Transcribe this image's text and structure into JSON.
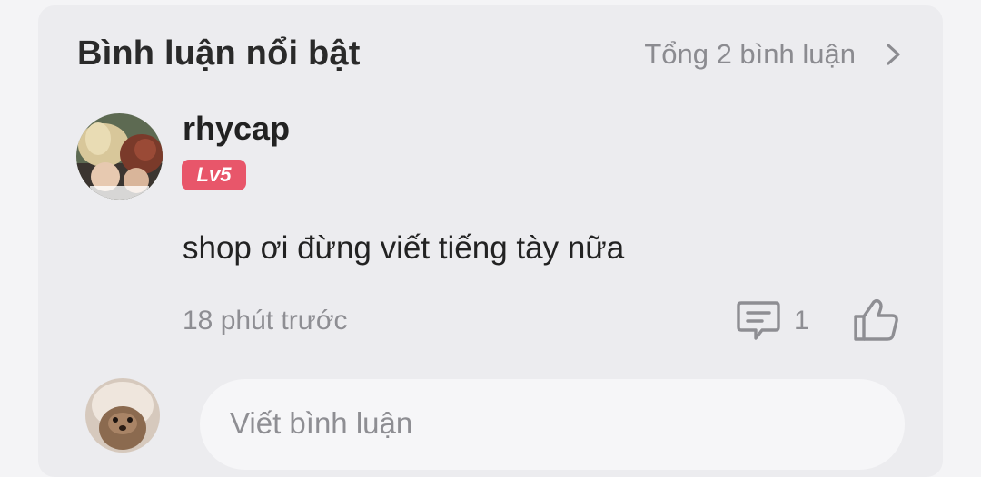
{
  "header": {
    "title": "Bình luận nổi bật",
    "total_label": "Tổng 2 bình luận",
    "chevron_icon": "chevron-right-icon"
  },
  "comment": {
    "username": "rhycap",
    "level": "Lv5",
    "text": "shop ơi đừng viết tiếng tày nữa",
    "timestamp": "18 phút trước",
    "reply_count": "1",
    "reply_icon": "comment-icon",
    "like_icon": "thumbs-up-icon"
  },
  "composer": {
    "placeholder": "Viết bình luận"
  },
  "colors": {
    "card_bg": "#ececef",
    "badge": "#e8566a",
    "muted_text": "#8e8e93"
  }
}
